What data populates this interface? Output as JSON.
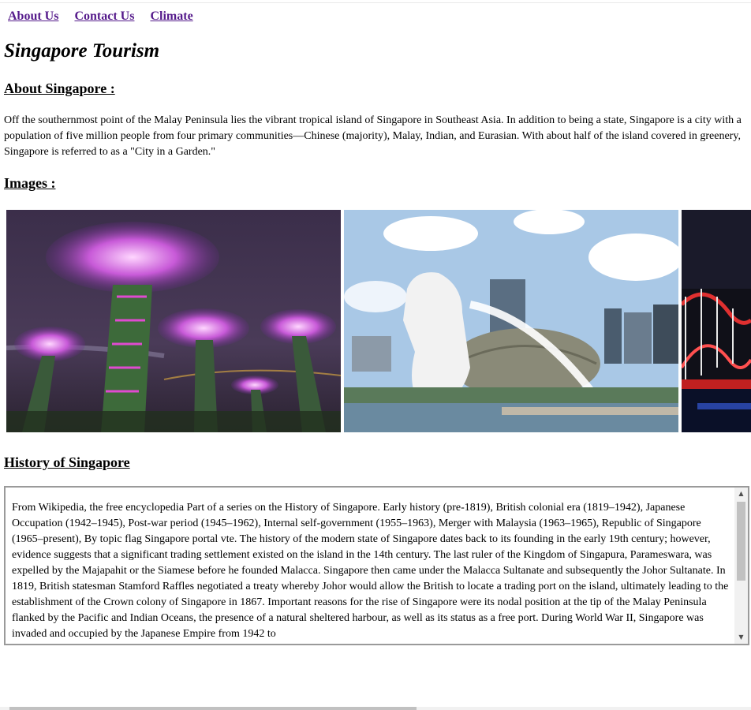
{
  "nav": {
    "links": [
      "About Us",
      "Contact Us",
      "Climate"
    ]
  },
  "page": {
    "title": "Singapore Tourism"
  },
  "about": {
    "heading": "About Singapore :",
    "text": "Off the southernmost point of the Malay Peninsula lies the vibrant tropical island of Singapore in Southeast Asia. In addition to being a state, Singapore is a city with a population of five million people from four primary communities—Chinese (majority), Malay, Indian, and Eurasian. With about half of the island covered in greenery, Singapore is referred to as a \"City in a Garden.\""
  },
  "images": {
    "heading": "Images :"
  },
  "history": {
    "heading": "History of Singapore",
    "text": "From Wikipedia, the free encyclopedia Part of a series on the History of Singapore. Early history (pre-1819), British colonial era (1819–1942), Japanese Occupation (1942–1945), Post-war period (1945–1962), Internal self-government (1955–1963), Merger with Malaysia (1963–1965), Republic of Singapore (1965–present), By topic flag Singapore portal vte. The history of the modern state of Singapore dates back to its founding in the early 19th century; however, evidence suggests that a significant trading settlement existed on the island in the 14th century. The last ruler of the Kingdom of Singapura, Parameswara, was expelled by the Majapahit or the Siamese before he founded Malacca. Singapore then came under the Malacca Sultanate and subsequently the Johor Sultanate. In 1819, British statesman Stamford Raffles negotiated a treaty whereby Johor would allow the British to locate a trading port on the island, ultimately leading to the establishment of the Crown colony of Singapore in 1867. Important reasons for the rise of Singapore were its nodal position at the tip of the Malay Peninsula flanked by the Pacific and Indian Oceans, the presence of a natural sheltered harbour, as well as its status as a free port. During World War II, Singapore was invaded and occupied by the Japanese Empire from 1942 to"
  },
  "scrollbar": {
    "up_icon": "arrow-up-icon",
    "down_icon": "arrow-down-icon"
  }
}
